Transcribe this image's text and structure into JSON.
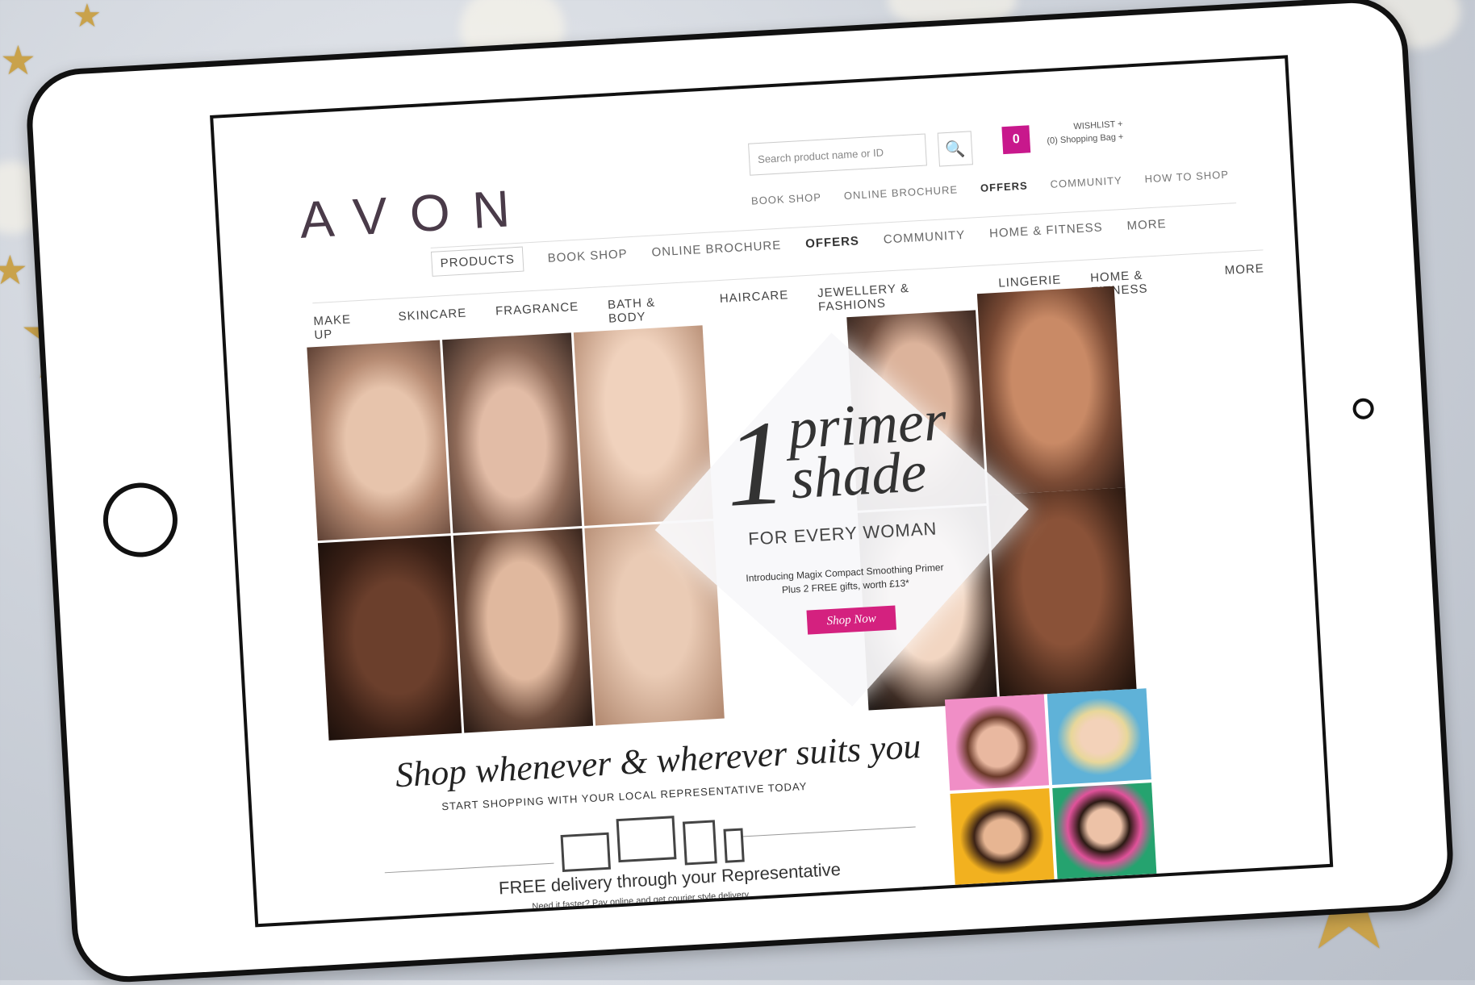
{
  "header": {
    "logo": "AVON",
    "search_placeholder": "Search product name or ID",
    "wishlist_line1": "WISHLIST +",
    "wishlist_line2": "(0) Shopping Bag +",
    "bag_count": "0"
  },
  "top_nav": [
    "BOOK SHOP",
    "ONLINE BROCHURE",
    "OFFERS",
    "COMMUNITY",
    "HOW TO SHOP"
  ],
  "nav_row2": [
    "PRODUCTS",
    "BOOK SHOP",
    "ONLINE BROCHURE",
    "OFFERS",
    "COMMUNITY",
    "HOME & FITNESS",
    "MORE"
  ],
  "categories": [
    "MAKE UP",
    "SKINCARE",
    "FRAGRANCE",
    "BATH & BODY",
    "HAIRCARE",
    "JEWELLERY & FASHIONS",
    "LINGERIE",
    "HOME & FITNESS",
    "MORE"
  ],
  "hero": {
    "number": "1",
    "word1": "primer",
    "word2": "shade",
    "subtitle": "FOR EVERY WOMAN",
    "desc_line1": "Introducing Magix Compact Smoothing Primer",
    "desc_line2": "Plus 2 FREE gifts, worth £13*",
    "cta": "Shop Now"
  },
  "promo": {
    "tagline": "Shop whenever & wherever suits you",
    "tagline_sub": "START SHOPPING WITH YOUR LOCAL REPRESENTATIVE TODAY",
    "delivery": "FREE delivery through your Representative",
    "delivery_sub": "Need it faster? Pay online and get courier style delivery"
  },
  "colors": {
    "brand_pink": "#d4217f",
    "logo_purple": "#4a3b49",
    "star_gold": "#c9a24b"
  }
}
